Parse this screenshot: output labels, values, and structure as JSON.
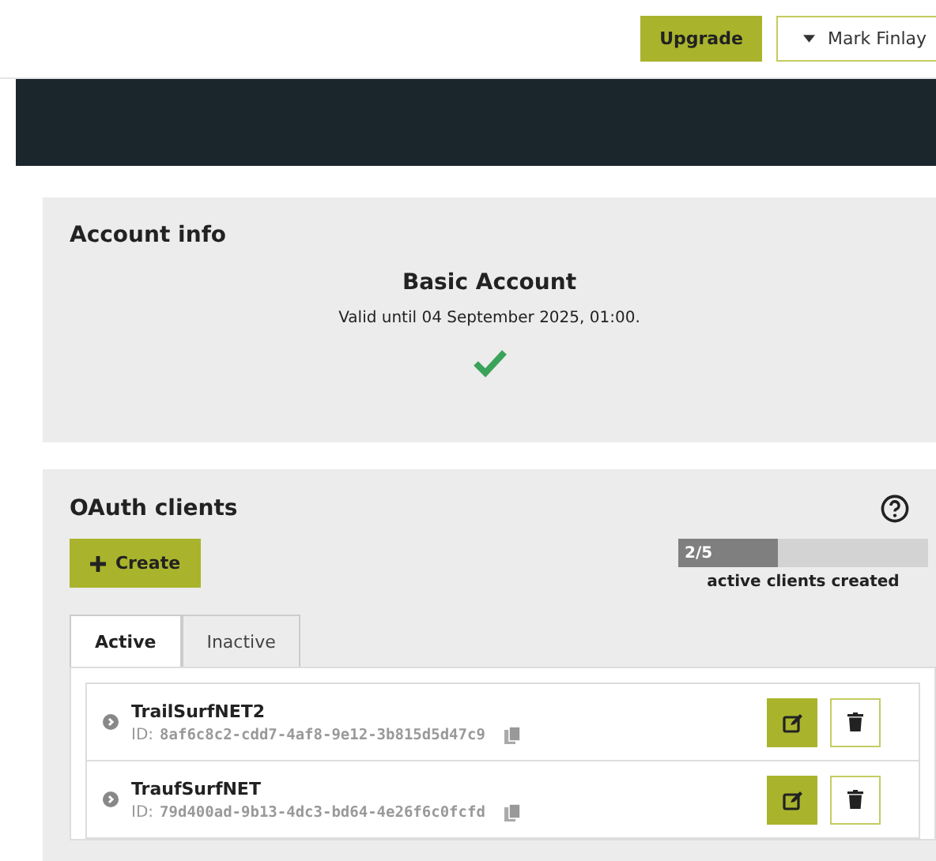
{
  "header": {
    "upgrade_button": "Upgrade",
    "user_menu": "Mark Finlay"
  },
  "account_info": {
    "title": "Account info",
    "plan": "Basic Account",
    "validity": "Valid until 04 September 2025, 01:00.",
    "valid": true
  },
  "oauth_clients": {
    "title": "OAuth clients",
    "create_button": "Create",
    "quota": {
      "reading": "2/5",
      "level": 0.4,
      "caption": "active clients created"
    },
    "tabs": [
      {
        "label": "Active",
        "selected": true
      },
      {
        "label": "Inactive",
        "selected": false
      }
    ],
    "clients": [
      {
        "name": "TrailSurfNET2",
        "id_label": "ID:",
        "id": "8af6c8c2-cdd7-4af8-9e12-3b815d5d47c9"
      },
      {
        "name": "TraufSurfNET",
        "id_label": "ID:",
        "id": "79d400ad-9b13-4dc3-bd64-4e26f6c0fcfd"
      }
    ]
  }
}
